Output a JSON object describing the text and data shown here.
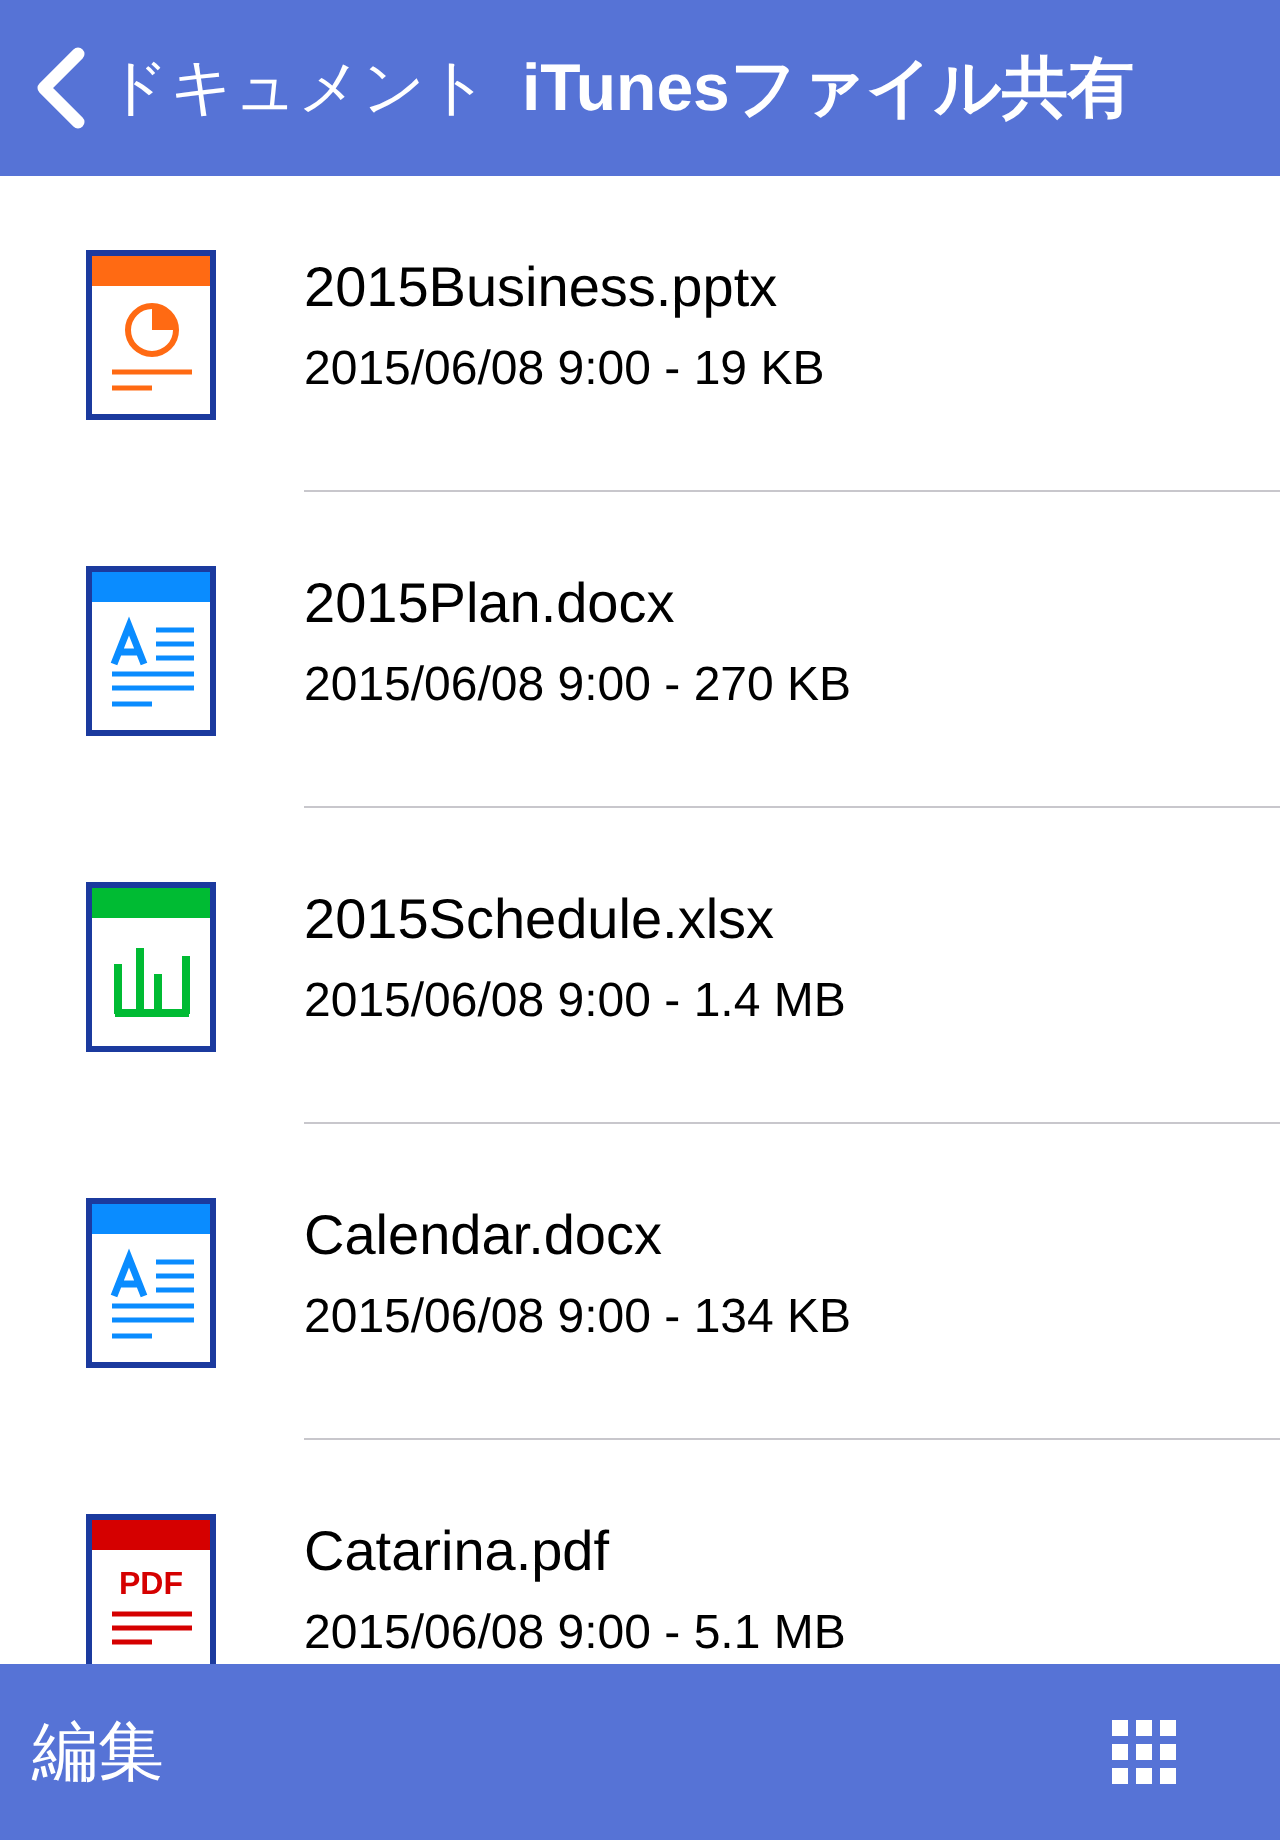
{
  "nav_bar": {
    "back_label": "ドキュメント",
    "title": "iTunesファイル共有"
  },
  "files": [
    {
      "kind": "presentation",
      "name": "2015Business.pptx",
      "details": "2015/06/08 9:00 - 19 KB"
    },
    {
      "kind": "document",
      "name": "2015Plan.docx",
      "details": "2015/06/08 9:00 - 270 KB"
    },
    {
      "kind": "spreadsheet",
      "name": "2015Schedule.xlsx",
      "details": "2015/06/08 9:00 - 1.4 MB"
    },
    {
      "kind": "document",
      "name": "Calendar.docx",
      "details": "2015/06/08 9:00 - 134 KB"
    },
    {
      "kind": "pdf",
      "icon_label": "PDF",
      "name": "Catarina.pdf",
      "details": "2015/06/08 9:00 - 5.1 MB"
    }
  ],
  "toolbar": {
    "edit_label": "編集"
  }
}
